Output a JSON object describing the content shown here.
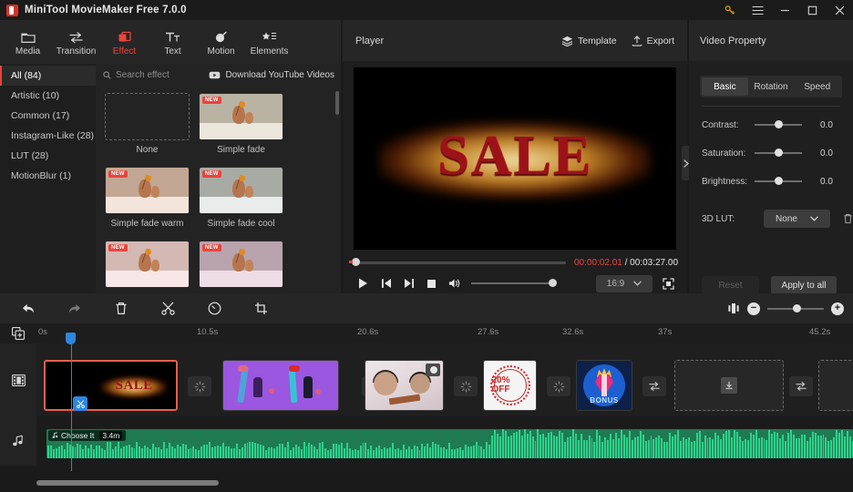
{
  "window": {
    "title": "MiniTool MovieMaker Free 7.0.0",
    "controls": {
      "key": "key-icon",
      "menu": "hamburger-icon",
      "minimize": "−",
      "maximize": "□",
      "close": "✕"
    }
  },
  "nav": {
    "tabs": [
      {
        "label": "Media",
        "icon": "folder-icon",
        "active": false
      },
      {
        "label": "Transition",
        "icon": "transition-icon",
        "active": false
      },
      {
        "label": "Effect",
        "icon": "effect-icon",
        "active": true
      },
      {
        "label": "Text",
        "icon": "text-icon",
        "active": false
      },
      {
        "label": "Motion",
        "icon": "motion-icon",
        "active": false
      },
      {
        "label": "Elements",
        "icon": "elements-icon",
        "active": false
      }
    ]
  },
  "categories": [
    {
      "label": "All (84)",
      "active": true
    },
    {
      "label": "Artistic (10)",
      "active": false
    },
    {
      "label": "Common (17)",
      "active": false
    },
    {
      "label": "Instagram-Like (28)",
      "active": false
    },
    {
      "label": "LUT (28)",
      "active": false
    },
    {
      "label": "MotionBlur (1)",
      "active": false
    }
  ],
  "effects": {
    "search_placeholder": "Search effect",
    "youtube_label": "Download YouTube Videos",
    "badge_new": "NEW",
    "items": [
      {
        "name": "None",
        "new": false,
        "wall": "#232323",
        "table": "#232323",
        "none": true
      },
      {
        "name": "Simple fade",
        "new": true,
        "wall": "#b9b3a4",
        "table": "#ece7dc"
      },
      {
        "name": "Simple fade warm",
        "new": true,
        "wall": "#c2a795",
        "table": "#f3e5dc"
      },
      {
        "name": "Simple fade cool",
        "new": true,
        "wall": "#a8aba4",
        "table": "#e9ecea"
      },
      {
        "name": "",
        "new": true,
        "wall": "#d3b8b4",
        "table": "#f7e7e6"
      },
      {
        "name": "",
        "new": true,
        "wall": "#b9a3ad",
        "table": "#efdde6"
      }
    ]
  },
  "player": {
    "title": "Player",
    "template_label": "Template",
    "export_label": "Export",
    "preview_text": "SALE",
    "current_time": "00:00:02.01",
    "separator": " / ",
    "total_time": "00:03:27.00",
    "aspect_ratio": "16:9"
  },
  "property": {
    "title": "Video Property",
    "tabs": [
      {
        "label": "Basic",
        "active": true
      },
      {
        "label": "Rotation",
        "active": false
      },
      {
        "label": "Speed",
        "active": false
      }
    ],
    "rows": [
      {
        "label": "Contrast:",
        "value": "0.0"
      },
      {
        "label": "Saturation:",
        "value": "0.0"
      },
      {
        "label": "Brightness:",
        "value": "0.0"
      }
    ],
    "lut_label": "3D LUT:",
    "lut_value": "None",
    "reset_label": "Reset",
    "apply_label": "Apply to all"
  },
  "timeline": {
    "tools": [
      {
        "name": "undo-icon",
        "enabled": true
      },
      {
        "name": "redo-icon",
        "enabled": false
      },
      {
        "name": "delete-icon",
        "enabled": true
      },
      {
        "name": "split-icon",
        "enabled": true
      },
      {
        "name": "speed-icon",
        "enabled": true
      },
      {
        "name": "crop-icon",
        "enabled": true
      }
    ],
    "ruler_ticks": [
      "0s",
      "10.5s",
      "20.6s",
      "27.6s",
      "32.6s",
      "37s",
      "45.2s"
    ],
    "video_clips": [
      {
        "kind": "sale",
        "label": "SALE",
        "selected": true
      },
      {
        "kind": "purple",
        "label": "",
        "selected": false
      },
      {
        "kind": "photo",
        "label": "",
        "selected": false
      },
      {
        "kind": "stamp",
        "label": "20% OFF",
        "selected": false
      },
      {
        "kind": "bonus",
        "label": "BONUS",
        "selected": false
      }
    ],
    "audio": {
      "name": "Choose It",
      "duration": "3.4m"
    },
    "placeholder_icon": "download-icon",
    "transition_icon": "transition-arrows-icon"
  },
  "colors": {
    "accent": "#e8453c",
    "selection": "#e8604c",
    "playhead": "#2e86e0",
    "audio": "#2fd18c"
  }
}
